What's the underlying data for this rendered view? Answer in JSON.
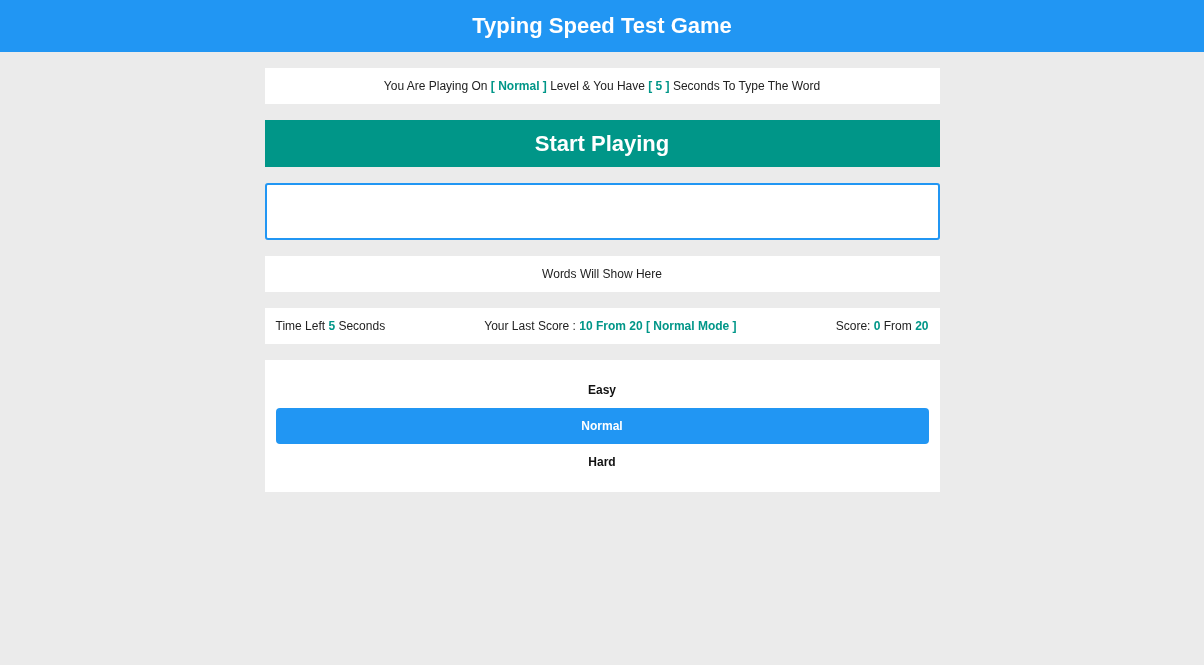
{
  "header": {
    "title": "Typing Speed Test Game"
  },
  "info": "You Are Playing On **[ Normal ]** Level & You Have **[ 5 ]** Seconds To Type The Word",
  "start_button": "Start Playing",
  "words": "Words Will Show Here",
  "stats": {
    "time_left": "Time Left **5** Seconds",
    "last_score": "Your Last Score : **10 From 20 [ Normal Mode ]**",
    "score": "Score: **0** From **20**"
  },
  "levels": [
    {
      "label": "Easy",
      "selected": false
    },
    {
      "label": "Normal",
      "selected": true
    },
    {
      "label": "Hard",
      "selected": false
    }
  ]
}
